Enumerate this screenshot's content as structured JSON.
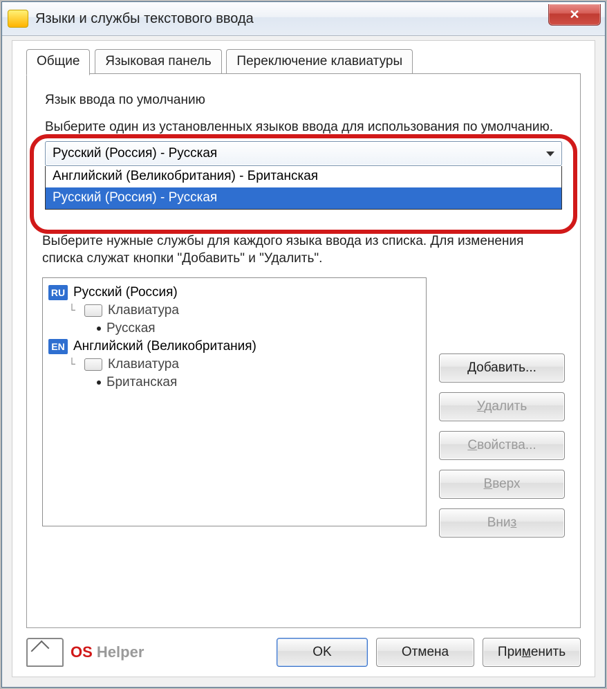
{
  "window": {
    "title": "Языки и службы текстового ввода"
  },
  "tabs": {
    "general": "Общие",
    "langbar": "Языковая панель",
    "keyswitch": "Переключение клавиатуры"
  },
  "group_default": {
    "title": "Язык ввода по умолчанию",
    "desc": "Выберите один из установленных языков ввода для использования по умолчанию."
  },
  "combo": {
    "selected": "Русский (Россия) - Русская",
    "option1": "Английский (Великобритания) - Британская",
    "option2": "Русский (Россия) - Русская"
  },
  "group_services": {
    "desc": "Выберите нужные службы для каждого языка ввода из списка. Для изменения списка служат кнопки \"Добавить\" и \"Удалить\"."
  },
  "tree": {
    "ru_label": "Русский (Россия)",
    "kbd_label": "Клавиатура",
    "ru_layout": "Русская",
    "en_label": "Английский (Великобритания)",
    "en_layout": "Британская",
    "badge_ru": "RU",
    "badge_en": "EN"
  },
  "buttons": {
    "add": "Добавить...",
    "remove": "Удалить",
    "props": "Свойства...",
    "up": "Вверх",
    "down": "Вниз",
    "ok": "OK",
    "cancel": "Отмена",
    "apply": "Применить"
  },
  "watermark": {
    "os": "OS ",
    "helper": "Helper"
  }
}
